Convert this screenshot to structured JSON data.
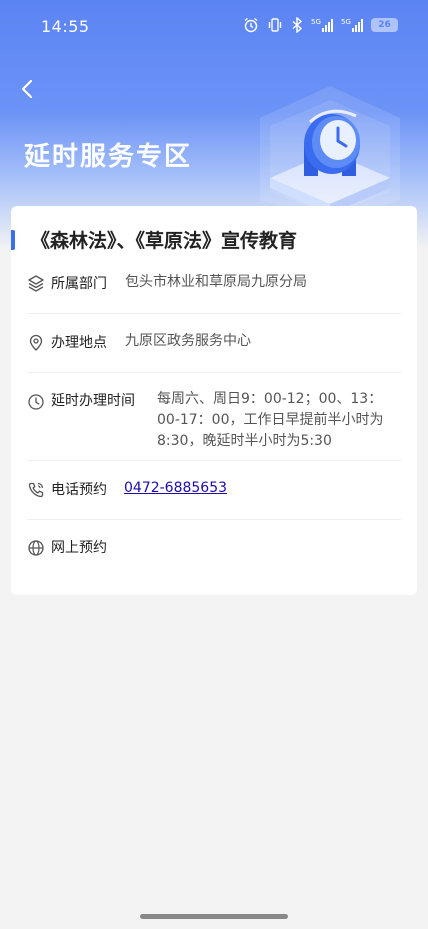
{
  "status_bar": {
    "time": "14:55",
    "battery": "26",
    "icons": [
      "alarm-icon",
      "vibrate-icon",
      "bluetooth-icon",
      "signal-5g-icon",
      "signal-5g-icon",
      "battery-icon"
    ]
  },
  "header": {
    "back_icon": "chevron-left-icon",
    "title": "延时服务专区"
  },
  "card": {
    "title": "《森林法》、《草原法》宣传教育",
    "rows": [
      {
        "icon": "layers-icon",
        "label": "所属部门",
        "value": "包头市林业和草原局九原分局"
      },
      {
        "icon": "location-pin-icon",
        "label": "办理地点",
        "value": "九原区政务服务中心"
      },
      {
        "icon": "clock-icon",
        "label": "延时办理时间",
        "value": "每周六、周日9：00-12；00、13：00-17：00，工作日早提前半小时为8:30，晚延时半小时为5:30"
      },
      {
        "icon": "phone-icon",
        "label": "电话预约",
        "value": "0472-6885653"
      },
      {
        "icon": "globe-icon",
        "label": "网上预约",
        "value": ""
      }
    ]
  },
  "colors": {
    "header_blue": "#5b84f3",
    "accent": "#3c6ff0",
    "link": "#1a0dab"
  }
}
